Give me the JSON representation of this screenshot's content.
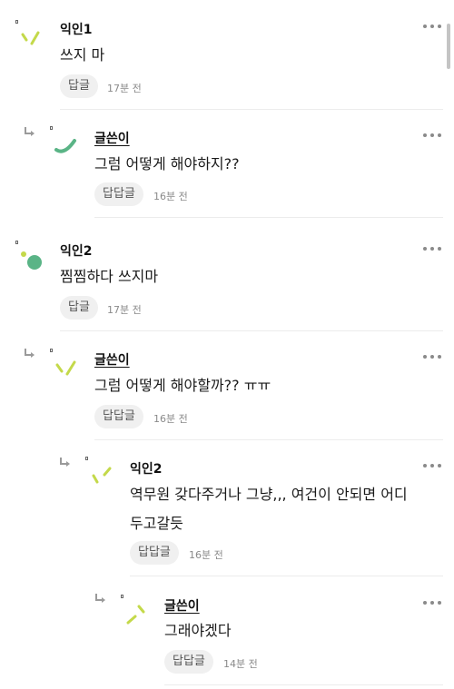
{
  "comments": [
    {
      "author": "익인1",
      "text": "쓰지 마",
      "reply_label": "답글",
      "time": "17분 전"
    },
    {
      "author": "글쓴이",
      "text": "그럼 어떻게 해야하지??",
      "reply_label": "답답글",
      "time": "16분 전"
    },
    {
      "author": "익인2",
      "text": "찜찜하다 쓰지마",
      "reply_label": "답글",
      "time": "17분 전"
    },
    {
      "author": "글쓴이",
      "text": "그럼 어떻게 해야할까?? ㅠㅠ",
      "reply_label": "답답글",
      "time": "16분 전"
    },
    {
      "author": "익인2",
      "text_line1": "역무원 갖다주거나 그냥,,, 여건이 안되면 어디",
      "text_line2": "두고갈듯",
      "reply_label": "답답글",
      "time": "16분 전"
    },
    {
      "author": "글쓴이",
      "text": "그래야겠다",
      "reply_label": "답답글",
      "time": "14분 전"
    }
  ],
  "colors": {
    "avatar_lime": "#c4d94a",
    "avatar_green": "#5ab486",
    "avatar_lightgreen": "#b7d36a",
    "text": "#1a1a1a",
    "muted": "#8a8a8a",
    "pill_bg": "#f0f0f0"
  },
  "icons": [
    "more-options-icon",
    "reply-arrow-icon",
    "avatar-icon"
  ]
}
